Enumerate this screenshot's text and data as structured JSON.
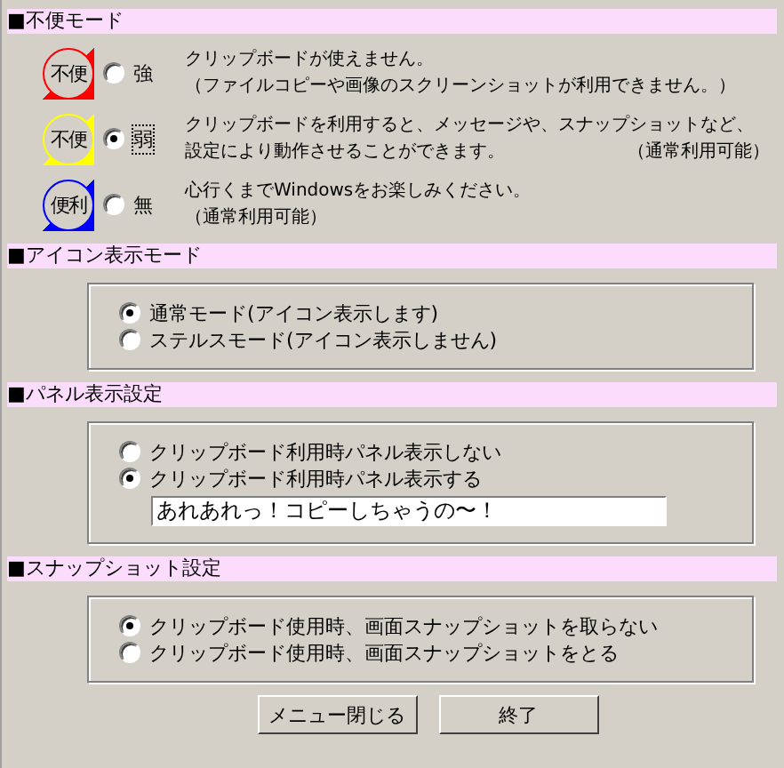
{
  "sections": [
    {
      "kind": "modes",
      "title": "■不便モード",
      "options": [
        {
          "badge": "不便",
          "color": "#ff0000",
          "label": "強",
          "selected": false,
          "lines": [
            {
              "text": "クリップボードが使えません。"
            },
            {
              "text": "（ファイルコピーや画像のスクリーンショットが利用できません。）"
            }
          ]
        },
        {
          "badge": "不便",
          "color": "#ffff00",
          "label": "弱",
          "selected": true,
          "lines": [
            {
              "text": "クリップボードを利用すると、メッセージや、スナップショットなど、"
            },
            {
              "text": "設定により動作させることができます。",
              "note": "（通常利用可能）"
            }
          ]
        },
        {
          "badge": "便利",
          "color": "#0000ff",
          "label": "無",
          "selected": false,
          "lines": [
            {
              "text": "心行くまでWindowsをお楽しみください。"
            },
            {
              "text": "（通常利用可能）"
            }
          ]
        }
      ]
    },
    {
      "kind": "group",
      "title": "■アイコン表示モード",
      "options": [
        {
          "label": "通常モード(アイコン表示します)",
          "selected": true
        },
        {
          "label": "ステルスモード(アイコン表示しません)",
          "selected": false
        }
      ]
    },
    {
      "kind": "group",
      "title": "■パネル表示設定",
      "options": [
        {
          "label": "クリップボード利用時パネル表示しない",
          "selected": false
        },
        {
          "label": "クリップボード利用時パネル表示する",
          "selected": true
        }
      ],
      "field": {
        "value": "あれあれっ！コピーしちゃうの〜！"
      }
    },
    {
      "kind": "group",
      "title": "■スナップショット設定",
      "options": [
        {
          "label": "クリップボード使用時、画面スナップショットを取らない",
          "selected": true
        },
        {
          "label": "クリップボード使用時、画面スナップショットをとる",
          "selected": false
        }
      ]
    }
  ],
  "buttons": [
    "メニュー閉じる",
    "終了"
  ]
}
